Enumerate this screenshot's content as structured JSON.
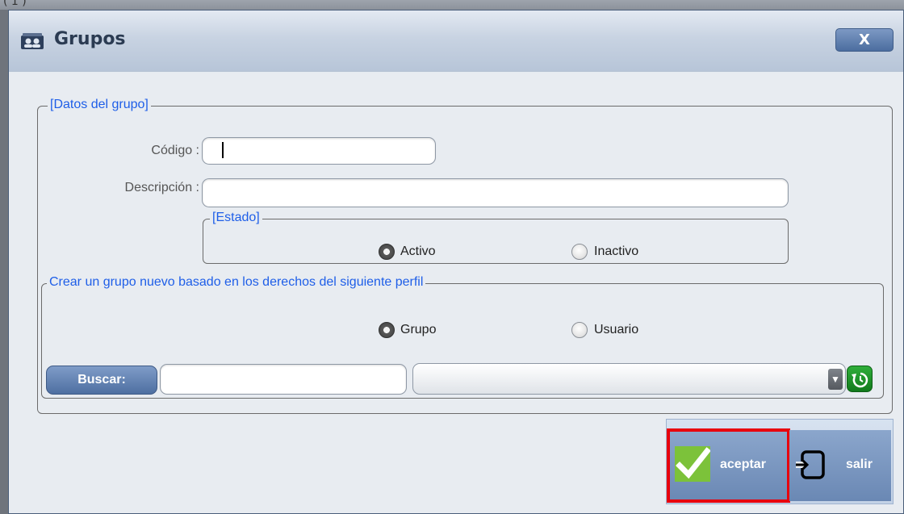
{
  "background_fragment": "( 1 )",
  "window": {
    "title": "Grupos",
    "close_label": "X"
  },
  "datos": {
    "legend": "[Datos del grupo]",
    "codigo_label": "Código :",
    "codigo_value": "",
    "descripcion_label": "Descripción :",
    "descripcion_value": ""
  },
  "estado": {
    "legend": "[Estado]",
    "options": [
      "Activo",
      "Inactivo"
    ],
    "selected": "Activo"
  },
  "perfil": {
    "legend": "Crear un grupo nuevo basado en los derechos del siguiente perfil",
    "options": [
      "Grupo",
      "Usuario"
    ],
    "selected": "Grupo",
    "buscar_label": "Buscar:",
    "search_value": "",
    "combo_value": ""
  },
  "actions": {
    "aceptar_label": "aceptar",
    "salir_label": "salir",
    "highlight_color": "#e8000d"
  }
}
